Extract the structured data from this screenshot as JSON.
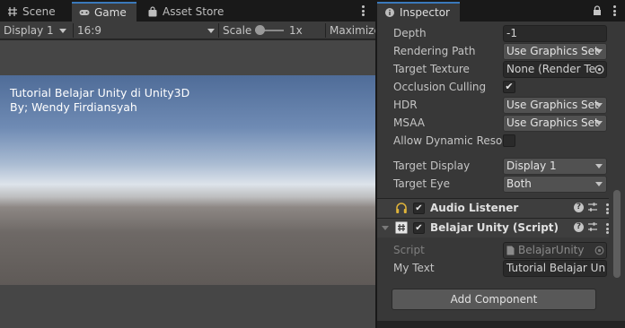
{
  "game_panel": {
    "tabs": [
      {
        "label": "Scene",
        "icon": "grid-hash-icon"
      },
      {
        "label": "Game",
        "icon": "gamepad-icon"
      },
      {
        "label": "Asset Store",
        "icon": "shopping-bag-icon"
      }
    ],
    "toolbar": {
      "display": "Display 1",
      "aspect": "16:9",
      "scale_label": "Scale",
      "scale_value": "1x",
      "maximize_label": "Maximize"
    },
    "overlay": {
      "line1": "Tutorial Belajar Unity di Unity3D",
      "line2": "By; Wendy Firdiansyah"
    }
  },
  "inspector": {
    "tab_label": "Inspector",
    "camera_fields": [
      {
        "label": "Depth",
        "value": "-1"
      },
      {
        "label": "Rendering Path",
        "value": "Use Graphics Set"
      },
      {
        "label": "Target Texture",
        "value": "None (Render Te"
      },
      {
        "label": "Occlusion Culling",
        "checked": true
      },
      {
        "label": "HDR",
        "value": "Use Graphics Set"
      },
      {
        "label": "MSAA",
        "value": "Use Graphics Set"
      },
      {
        "label": "Allow Dynamic Resol",
        "checked": false
      },
      {
        "label": "Target Display",
        "value": "Display 1"
      },
      {
        "label": "Target Eye",
        "value": "Both"
      }
    ],
    "audio_listener": {
      "title": "Audio Listener",
      "enabled": true,
      "icon": "headphones-icon"
    },
    "script_component": {
      "title": "Belajar Unity (Script)",
      "enabled": true,
      "icon": "script-hash-icon",
      "script_label": "Script",
      "script_value": "BelajarUnity",
      "mytext_label": "My Text",
      "mytext_value": "Tutorial Belajar Unit"
    },
    "add_component_label": "Add Component"
  },
  "colors": {
    "accent": "#3a79bb",
    "panel": "#383838",
    "tabbar": "#191919"
  }
}
